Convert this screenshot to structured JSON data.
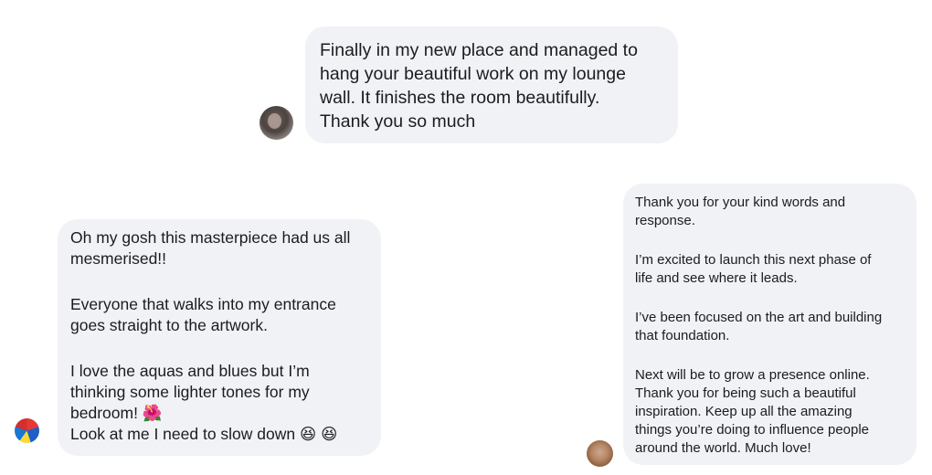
{
  "messages": [
    {
      "sender": "other",
      "text": "Finally in my new place and managed to\nhang your beautiful work on my lounge\nwall. It finishes the room beautifully.\nThank you so much"
    },
    {
      "sender": "other",
      "paragraphs": [
        "Oh my gosh this masterpiece had us all\nmesmerised!!",
        "Everyone that walks into my entrance\ngoes straight to the artwork.",
        "I love the aquas and blues but I’m\nthinking  some lighter tones for my\nbedroom! 🌺\nLook at me I need to slow down 😆 😆"
      ]
    },
    {
      "sender": "me",
      "paragraphs": [
        "Thank you for your kind words and\nresponse.",
        "I’m excited to launch this next phase of\nlife and see where it leads.",
        "I’ve been focused on the art and building\nthat foundation.",
        "Next will be to grow a presence online.\nThank you for being such a beautiful\ninspiration. Keep up all the amazing\nthings you’re doing to influence people\naround the world. Much love!"
      ]
    }
  ]
}
